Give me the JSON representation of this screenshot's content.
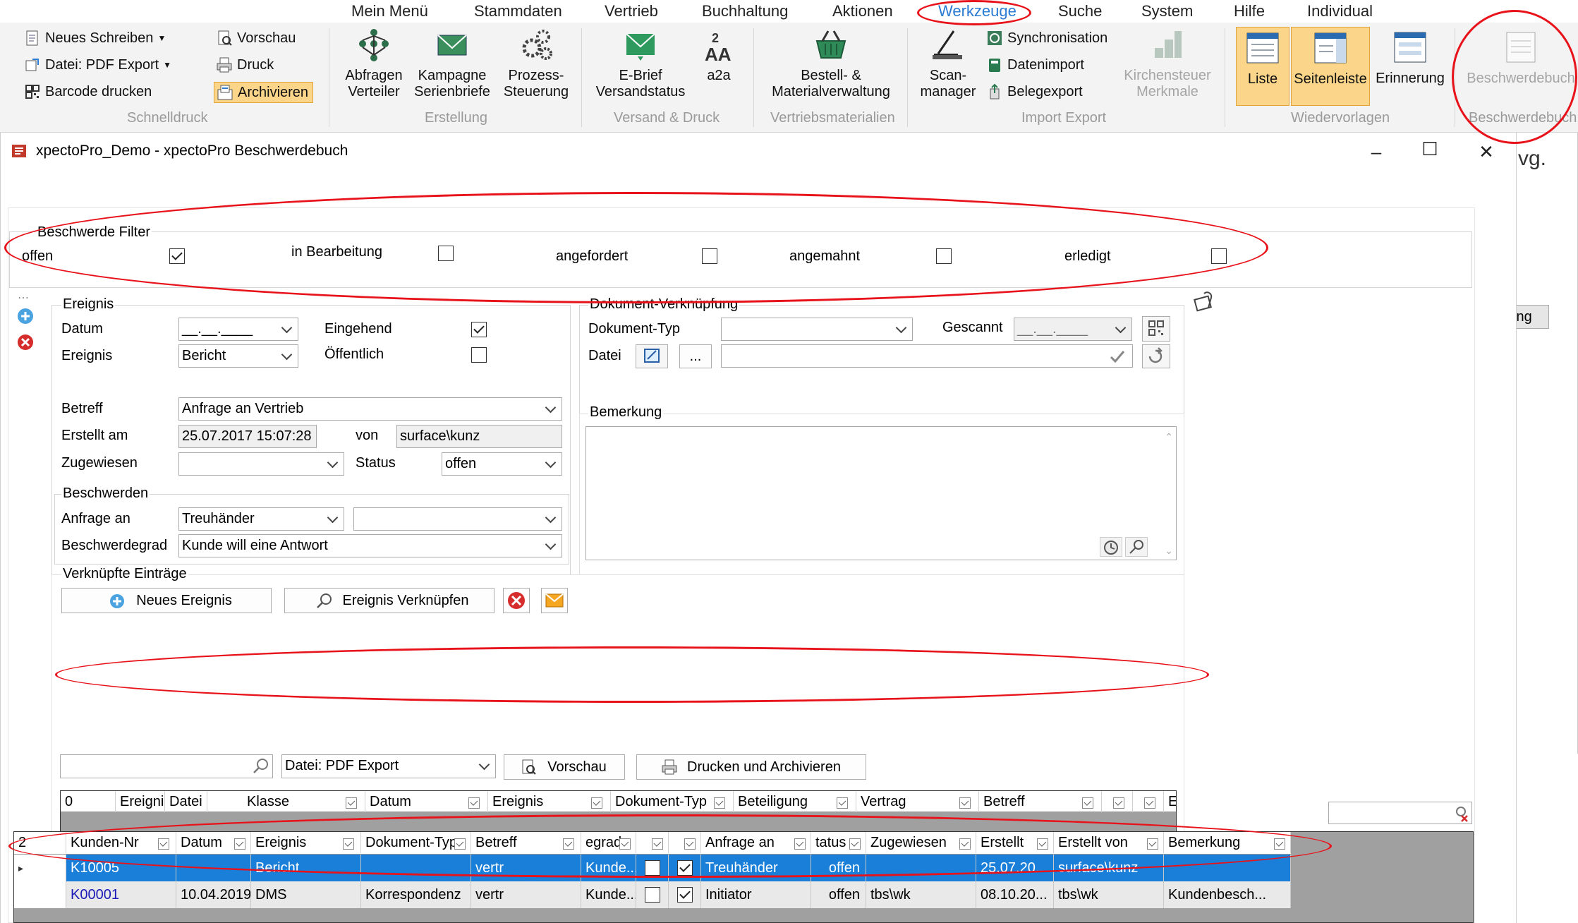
{
  "menu": {
    "tabs": [
      "Mein Menü",
      "Stammdaten",
      "Vertrieb",
      "Buchhaltung",
      "Aktionen",
      "Werkzeuge",
      "Suche",
      "System",
      "Hilfe",
      "Individual"
    ],
    "active": "Werkzeuge"
  },
  "ribbon": {
    "schnelldruck": {
      "label": "Schnelldruck",
      "neues_schreiben": "Neues Schreiben",
      "pdf_export": "Datei: PDF Export",
      "barcode": "Barcode drucken",
      "vorschau": "Vorschau",
      "druck": "Druck",
      "archivieren": "Archivieren"
    },
    "erstellung": {
      "label": "Erstellung",
      "abfragen_l1": "Abfragen",
      "abfragen_l2": "Verteiler",
      "kampagne_l1": "Kampagne",
      "kampagne_l2": "Serienbriefe",
      "prozess_l1": "Prozess-",
      "prozess_l2": "Steuerung"
    },
    "versand": {
      "label": "Versand & Druck",
      "ebrief_l1": "E-Brief",
      "ebrief_l2": "Versandstatus",
      "a2a": "a2a"
    },
    "vertriebsmaterialien": {
      "label": "Vertriebsmaterialien",
      "bestell_l1": "Bestell- &",
      "bestell_l2": "Materialverwaltung"
    },
    "importexport": {
      "label": "Import Export",
      "scan_l1": "Scan-",
      "scan_l2": "manager",
      "sync": "Synchronisation",
      "datenimport": "Datenimport",
      "belegexport": "Belegexport",
      "kirchen_l1": "Kirchensteuer",
      "kirchen_l2": "Merkmale"
    },
    "wiedervorlagen": {
      "label": "Wiedervorlagen",
      "liste": "Liste",
      "seitenleiste": "Seitenleiste",
      "erinnerung": "Erinnerung"
    },
    "beschwerde": {
      "label": "Beschwerdebuch",
      "button": "Beschwerdebuch"
    }
  },
  "window": {
    "title": "xpectoPro_Demo - xpectoPro Beschwerdebuch",
    "behind_text_1": "vg.",
    "behind_text_2": "ing"
  },
  "filter": {
    "title": "Beschwerde Filter",
    "items": [
      {
        "label": "offen",
        "checked": true
      },
      {
        "label": "in Bearbeitung",
        "checked": false
      },
      {
        "label": "angefordert",
        "checked": false
      },
      {
        "label": "angemahnt",
        "checked": false
      },
      {
        "label": "erledigt",
        "checked": false
      }
    ]
  },
  "ereignis": {
    "title": "Ereignis",
    "datum_label": "Datum",
    "datum_value": "__.__.____",
    "ereignis_label": "Ereignis",
    "ereignis_value": "Bericht",
    "eingehend_label": "Eingehend",
    "eingehend_checked": true,
    "oeffentlich_label": "Öffentlich",
    "oeffentlich_checked": false,
    "betreff_label": "Betreff",
    "betreff_value": "Anfrage an Vertrieb",
    "erstellt_label": "Erstellt am",
    "erstellt_value": "25.07.2017 15:07:28",
    "von_label": "von",
    "von_value": "surface\\kunz",
    "zugewiesen_label": "Zugewiesen",
    "zugewiesen_value": "",
    "status_label": "Status",
    "status_value": "offen"
  },
  "beschwerden": {
    "title": "Beschwerden",
    "anfrage_label": "Anfrage an",
    "anfrage_value": "Treuhänder",
    "anfrage_value2": "",
    "grad_label": "Beschwerdegrad",
    "grad_value": "Kunde will eine Antwort"
  },
  "dokument": {
    "title": "Dokument-Verknüpfung",
    "typ_label": "Dokument-Typ",
    "typ_value": "",
    "gescannt_label": "Gescannt",
    "gescannt_value": "__.__.____",
    "datei_label": "Datei",
    "dots": "..."
  },
  "bemerkung": {
    "title": "Bemerkung",
    "value": ""
  },
  "verknuepft": {
    "title": "Verknüpfte Einträge",
    "neues_ereignis": "Neues Ereignis",
    "ereignis_verknuepfen": "Ereignis Verknüpfen",
    "search_value": "",
    "export_value": "Datei: PDF Export",
    "vorschau": "Vorschau",
    "drucken": "Drucken und Archivieren",
    "columns": [
      "0",
      "Ereigni",
      "Datei",
      "Klasse",
      "Datum",
      "Ereignis",
      "Dokument-Typ",
      "Beteiligung",
      "Vertrag",
      "Betreff",
      "",
      "",
      "E"
    ]
  },
  "grid": {
    "search_value": "",
    "columns": [
      "2",
      "Kunden-Nr",
      "Datum",
      "Ereignis",
      "Dokument-Typ",
      "Betreff",
      "egrad",
      "",
      "",
      "Anfrage an",
      "tatus",
      "Zugewiesen",
      "Erstellt",
      "Erstellt von",
      "Bemerkung"
    ],
    "rows": [
      {
        "marker": "▸",
        "kunden_nr": "K10005",
        "datum": "",
        "ereignis": "Bericht",
        "dokument_typ": "",
        "betreff": "vertr",
        "grad": "Kunde...",
        "chk1": false,
        "chk2": true,
        "anfrage": "Treuhänder",
        "status": "offen",
        "zugewiesen": "",
        "erstellt": "25.07.20...",
        "erstellt_von": "surface\\kunz",
        "bemerkung": ""
      },
      {
        "marker": "",
        "kunden_nr": "K00001",
        "datum": "10.04.2019",
        "ereignis": "DMS",
        "dokument_typ": "Korrespondenz",
        "betreff": "vertr",
        "grad": "Kunde...",
        "chk1": false,
        "chk2": true,
        "anfrage": "Initiator",
        "status": "offen",
        "zugewiesen": "tbs\\wk",
        "erstellt": "08.10.20...",
        "erstellt_von": "tbs\\wk",
        "bemerkung": "Kundenbesch..."
      }
    ]
  },
  "colors": {
    "accent": "#2b7cd3",
    "selected_row": "#1a7fd9",
    "highlight": "#fbd68a",
    "annotation": "#e8121a",
    "grid_bg": "#a0a0a0"
  }
}
